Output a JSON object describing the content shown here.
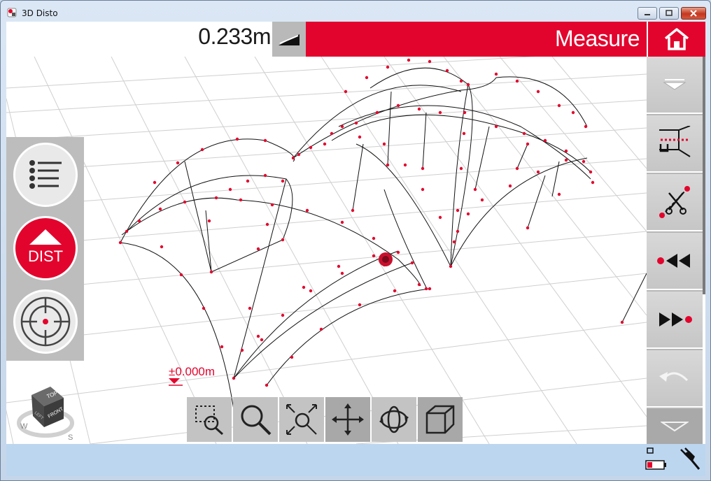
{
  "window": {
    "title": "3D Disto",
    "minimize_label": "",
    "maximize_label": "",
    "close_label": ""
  },
  "top_bar": {
    "distance_value": "0.233m",
    "mode_title": "Measure"
  },
  "left_panel": {
    "dist_label": "DIST"
  },
  "viewport": {
    "height_label": "±0.000m"
  },
  "cube": {
    "top": "TOP",
    "front": "FRONT",
    "left": "LEFT",
    "compass_w": "W",
    "compass_s": "S"
  },
  "colors": {
    "accent": "#e3042d",
    "panel": "#bdbdbd",
    "status": "#bcd6f0"
  },
  "icons": {
    "home": "home-icon",
    "slope": "slope-icon",
    "list": "list-icon",
    "target": "target-icon",
    "down_arrow": "down-arrow-icon",
    "room": "room-icon",
    "scissors": "scissors-icon",
    "rewind": "rewind-icon",
    "forward": "forward-icon",
    "undo": "undo-icon",
    "zoom_window": "zoom-window-icon",
    "zoom": "zoom-icon",
    "zoom_extents": "zoom-extents-icon",
    "pan": "pan-icon",
    "orbit": "orbit-icon",
    "box_view": "box-view-icon",
    "battery": "battery-icon",
    "plug": "plug-icon"
  }
}
